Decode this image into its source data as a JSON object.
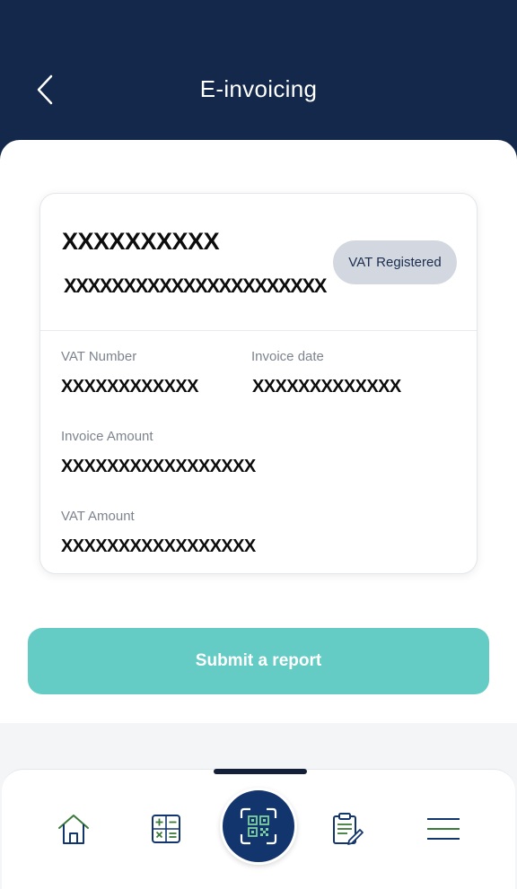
{
  "header": {
    "title": "E-invoicing",
    "background": "#13284a"
  },
  "card": {
    "merchant_name": "XXXXXXXXXX",
    "merchant_detail": "XXXXXXXXXXXXXXXXXXXXXX",
    "badge": "VAT Registered",
    "fields": {
      "vat_number_label": "VAT Number",
      "vat_number_value": "XXXXXXXXXXXX",
      "invoice_date_label": "Invoice date",
      "invoice_date_value": "XXXXXXXXXXXXX",
      "invoice_amount_label": "Invoice Amount",
      "invoice_amount_value": "XXXXXXXXXXXXXXXXX",
      "vat_amount_label": "VAT Amount",
      "vat_amount_value": "XXXXXXXXXXXXXXXXX"
    }
  },
  "actions": {
    "submit_label": "Submit a report",
    "submit_color": "#64cbc5"
  },
  "nav": {
    "items": [
      "home-icon",
      "calculator-icon",
      "qr-scan-icon",
      "clipboard-edit-icon",
      "menu-icon"
    ],
    "accent": "#3a7a3a",
    "primary": "#13356e"
  }
}
